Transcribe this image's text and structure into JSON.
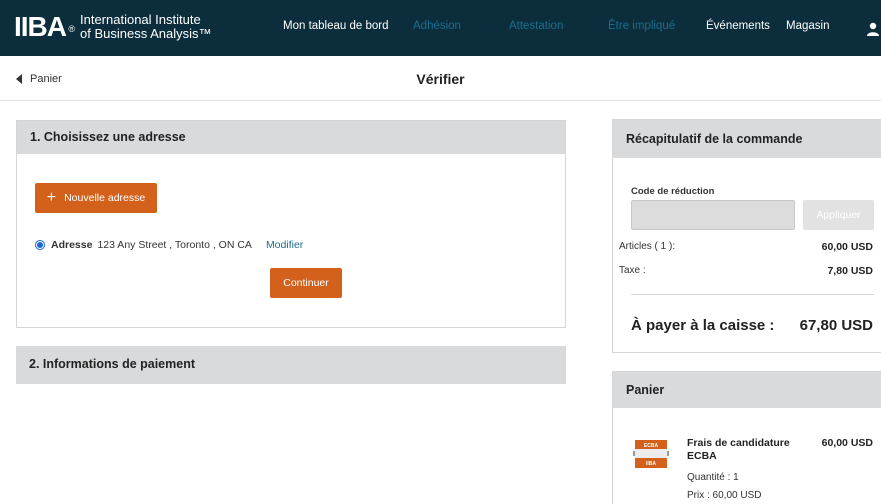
{
  "nav": {
    "logo_mark": "IIBA",
    "logo_line1": "International Institute",
    "logo_line2": "of Business Analysis™",
    "items": [
      {
        "label": "Mon tableau de bord"
      },
      {
        "label": "Adhésion"
      },
      {
        "label": "Attestation"
      },
      {
        "label": "Être impliqué"
      },
      {
        "label": "Événements"
      },
      {
        "label": "Magasin"
      }
    ]
  },
  "subheader": {
    "back_label": "Panier",
    "title": "Vérifier"
  },
  "address_section": {
    "title": "1. Choisissez une adresse",
    "new_address_label": "Nouvelle adresse",
    "address_label": "Adresse",
    "address_value": "123 Any Street , Toronto , ON CA",
    "edit_label": "Modifier",
    "continue_label": "Continuer"
  },
  "payment_section": {
    "title": "2. Informations de paiement"
  },
  "summary": {
    "title": "Récapitulatif de la commande",
    "promo_label": "Code de réduction",
    "promo_value": "",
    "apply_label": "Appliquer",
    "items_label": "Articles ( 1 ):",
    "items_value": "60,00 USD",
    "tax_label": "Taxe :",
    "tax_value": "7,80 USD",
    "total_label": "À payer à la caisse :",
    "total_value": "67,80 USD"
  },
  "cart": {
    "title": "Panier",
    "item_name": "Frais de candidature ECBA",
    "item_price": "60,00 USD",
    "quantity_text": "Quantité :  1",
    "unit_price_text": "Prix : 60,00 USD",
    "badge_top": "ECBA",
    "badge_bottom": "IIBA"
  },
  "colors": {
    "nav_bg": "#0b2d3c",
    "accent_orange": "#d4611b",
    "link_teal": "#1c6e8e",
    "panel_header": "#d8dadc"
  }
}
